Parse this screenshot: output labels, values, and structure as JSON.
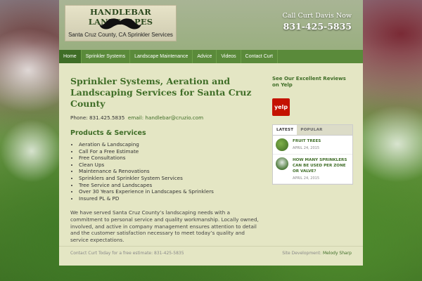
{
  "header": {
    "logo_title": "HANDLEBAR LANDSCAPES",
    "logo_subtitle": "Santa Cruz County, CA Sprinkler Services",
    "call_label": "Call Curt Davis Now",
    "call_phone": "831-425-5835"
  },
  "nav": {
    "items": [
      "Home",
      "Sprinkler Systems",
      "Landscape Maintenance",
      "Advice",
      "Videos",
      "Contact Curt"
    ],
    "active_index": 0
  },
  "main": {
    "title": "Sprinkler Systems, Aeration and Landscaping Services for Santa Cruz County",
    "phone_label": "Phone: 831.425.5835",
    "email_label": "email: handlebar@cruzio.com",
    "products_heading": "Products & Services",
    "products": [
      "Aeration & Landscaping",
      "Call For a Free Estimate",
      "Free Consultations",
      "Clean Ups",
      "Maintenance & Renovations",
      "Sprinklers and Sprinkler System Services",
      "Tree Service and Landscapes",
      "Over 30 Years Experience in Landscapes & Sprinklers",
      "Insured PL & PD"
    ],
    "paragraph": "We have served Santa Cruz County’s landscaping needs with a commitment to personal service and quality workmanship. Locally owned, involved, and active in company management ensures attention to detail and the customer satisfaction necessary to meet today’s quality and service expectations."
  },
  "sidebar": {
    "reviews_title": "See Our Excellent Reviews on Yelp",
    "yelp_label": "yelp",
    "tabs": [
      "LATEST",
      "POPULAR"
    ],
    "posts": [
      {
        "title": "FRUIT TREES",
        "date": "APRIL 24, 2015"
      },
      {
        "title": "HOW MANY SPRINKLERS CAN BE USED PER ZONE OR VALVE?",
        "date": "APRIL 24, 2015"
      }
    ]
  },
  "footer": {
    "left": "Contact Curt Today for a free estimate: 831-425-5835",
    "right_label": "Site Development:",
    "right_credit": "Melody Sharp"
  },
  "colors": {
    "accent": "#3f6d27",
    "nav": "#5a8a3a",
    "page_bg": "#e4e6c4",
    "yelp": "#c41200"
  }
}
